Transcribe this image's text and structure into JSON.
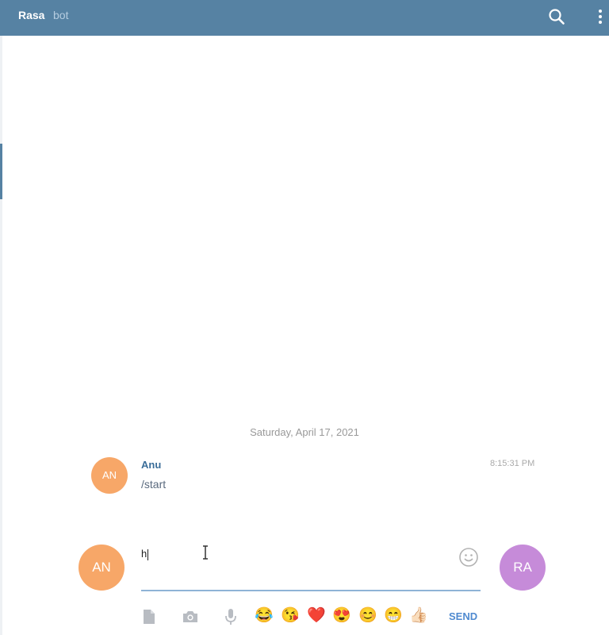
{
  "header": {
    "title": "Rasa",
    "subtitle": "bot",
    "bg_color": "#5682a3"
  },
  "chat": {
    "date_divider": "Saturday, April 17, 2021",
    "messages": [
      {
        "avatar_initials": "AN",
        "avatar_color": "#f7a768",
        "author": "Anu",
        "time": "8:15:31 PM",
        "text": "/start"
      }
    ]
  },
  "composer": {
    "self_avatar_initials": "AN",
    "peer_avatar_initials": "RA",
    "peer_avatar_color": "#c68bd9",
    "input_value": "h",
    "send_label": "SEND",
    "tools": [
      "file-icon",
      "camera-icon",
      "microphone-icon"
    ],
    "quick_emojis": [
      "😂",
      "😘",
      "❤️",
      "😍",
      "😊",
      "😁",
      "👍🏻"
    ]
  }
}
